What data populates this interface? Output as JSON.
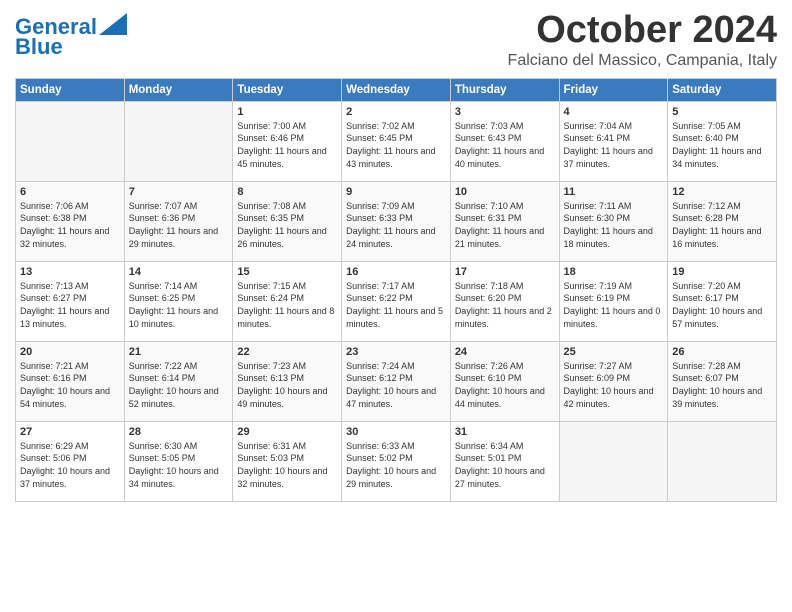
{
  "header": {
    "logo_line1": "General",
    "logo_line2": "Blue",
    "month": "October 2024",
    "location": "Falciano del Massico, Campania, Italy"
  },
  "days_of_week": [
    "Sunday",
    "Monday",
    "Tuesday",
    "Wednesday",
    "Thursday",
    "Friday",
    "Saturday"
  ],
  "weeks": [
    [
      {
        "day": "",
        "text": ""
      },
      {
        "day": "",
        "text": ""
      },
      {
        "day": "1",
        "text": "Sunrise: 7:00 AM\nSunset: 6:46 PM\nDaylight: 11 hours and 45 minutes."
      },
      {
        "day": "2",
        "text": "Sunrise: 7:02 AM\nSunset: 6:45 PM\nDaylight: 11 hours and 43 minutes."
      },
      {
        "day": "3",
        "text": "Sunrise: 7:03 AM\nSunset: 6:43 PM\nDaylight: 11 hours and 40 minutes."
      },
      {
        "day": "4",
        "text": "Sunrise: 7:04 AM\nSunset: 6:41 PM\nDaylight: 11 hours and 37 minutes."
      },
      {
        "day": "5",
        "text": "Sunrise: 7:05 AM\nSunset: 6:40 PM\nDaylight: 11 hours and 34 minutes."
      }
    ],
    [
      {
        "day": "6",
        "text": "Sunrise: 7:06 AM\nSunset: 6:38 PM\nDaylight: 11 hours and 32 minutes."
      },
      {
        "day": "7",
        "text": "Sunrise: 7:07 AM\nSunset: 6:36 PM\nDaylight: 11 hours and 29 minutes."
      },
      {
        "day": "8",
        "text": "Sunrise: 7:08 AM\nSunset: 6:35 PM\nDaylight: 11 hours and 26 minutes."
      },
      {
        "day": "9",
        "text": "Sunrise: 7:09 AM\nSunset: 6:33 PM\nDaylight: 11 hours and 24 minutes."
      },
      {
        "day": "10",
        "text": "Sunrise: 7:10 AM\nSunset: 6:31 PM\nDaylight: 11 hours and 21 minutes."
      },
      {
        "day": "11",
        "text": "Sunrise: 7:11 AM\nSunset: 6:30 PM\nDaylight: 11 hours and 18 minutes."
      },
      {
        "day": "12",
        "text": "Sunrise: 7:12 AM\nSunset: 6:28 PM\nDaylight: 11 hours and 16 minutes."
      }
    ],
    [
      {
        "day": "13",
        "text": "Sunrise: 7:13 AM\nSunset: 6:27 PM\nDaylight: 11 hours and 13 minutes."
      },
      {
        "day": "14",
        "text": "Sunrise: 7:14 AM\nSunset: 6:25 PM\nDaylight: 11 hours and 10 minutes."
      },
      {
        "day": "15",
        "text": "Sunrise: 7:15 AM\nSunset: 6:24 PM\nDaylight: 11 hours and 8 minutes."
      },
      {
        "day": "16",
        "text": "Sunrise: 7:17 AM\nSunset: 6:22 PM\nDaylight: 11 hours and 5 minutes."
      },
      {
        "day": "17",
        "text": "Sunrise: 7:18 AM\nSunset: 6:20 PM\nDaylight: 11 hours and 2 minutes."
      },
      {
        "day": "18",
        "text": "Sunrise: 7:19 AM\nSunset: 6:19 PM\nDaylight: 11 hours and 0 minutes."
      },
      {
        "day": "19",
        "text": "Sunrise: 7:20 AM\nSunset: 6:17 PM\nDaylight: 10 hours and 57 minutes."
      }
    ],
    [
      {
        "day": "20",
        "text": "Sunrise: 7:21 AM\nSunset: 6:16 PM\nDaylight: 10 hours and 54 minutes."
      },
      {
        "day": "21",
        "text": "Sunrise: 7:22 AM\nSunset: 6:14 PM\nDaylight: 10 hours and 52 minutes."
      },
      {
        "day": "22",
        "text": "Sunrise: 7:23 AM\nSunset: 6:13 PM\nDaylight: 10 hours and 49 minutes."
      },
      {
        "day": "23",
        "text": "Sunrise: 7:24 AM\nSunset: 6:12 PM\nDaylight: 10 hours and 47 minutes."
      },
      {
        "day": "24",
        "text": "Sunrise: 7:26 AM\nSunset: 6:10 PM\nDaylight: 10 hours and 44 minutes."
      },
      {
        "day": "25",
        "text": "Sunrise: 7:27 AM\nSunset: 6:09 PM\nDaylight: 10 hours and 42 minutes."
      },
      {
        "day": "26",
        "text": "Sunrise: 7:28 AM\nSunset: 6:07 PM\nDaylight: 10 hours and 39 minutes."
      }
    ],
    [
      {
        "day": "27",
        "text": "Sunrise: 6:29 AM\nSunset: 5:06 PM\nDaylight: 10 hours and 37 minutes."
      },
      {
        "day": "28",
        "text": "Sunrise: 6:30 AM\nSunset: 5:05 PM\nDaylight: 10 hours and 34 minutes."
      },
      {
        "day": "29",
        "text": "Sunrise: 6:31 AM\nSunset: 5:03 PM\nDaylight: 10 hours and 32 minutes."
      },
      {
        "day": "30",
        "text": "Sunrise: 6:33 AM\nSunset: 5:02 PM\nDaylight: 10 hours and 29 minutes."
      },
      {
        "day": "31",
        "text": "Sunrise: 6:34 AM\nSunset: 5:01 PM\nDaylight: 10 hours and 27 minutes."
      },
      {
        "day": "",
        "text": ""
      },
      {
        "day": "",
        "text": ""
      }
    ]
  ]
}
